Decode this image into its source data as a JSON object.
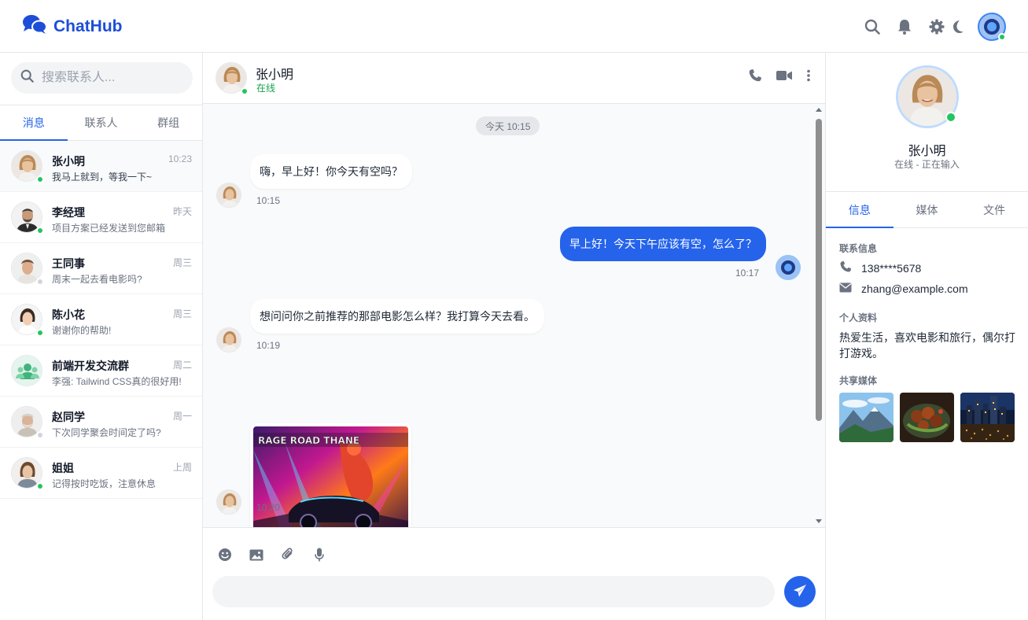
{
  "app": {
    "brand": "ChatHub"
  },
  "sidebar": {
    "search_placeholder": "搜索联系人...",
    "tabs": [
      {
        "label": "消息",
        "active": true
      },
      {
        "label": "联系人",
        "active": false
      },
      {
        "label": "群组",
        "active": false
      }
    ],
    "conversations": [
      {
        "name": "张小明",
        "time": "10:23",
        "preview": "我马上就到，等我一下~",
        "online": true
      },
      {
        "name": "李经理",
        "time": "昨天",
        "preview": "项目方案已经发送到您邮箱",
        "online": true
      },
      {
        "name": "王同事",
        "time": "周三",
        "preview": "周末一起去看电影吗?",
        "online": false
      },
      {
        "name": "陈小花",
        "time": "周三",
        "preview": "谢谢你的帮助!",
        "online": true
      },
      {
        "name": "前端开发交流群",
        "time": "周二",
        "preview": "李强: Tailwind CSS真的很好用!",
        "online": null
      },
      {
        "name": "赵同学",
        "time": "周一",
        "preview": "下次同学聚会时间定了吗?",
        "online": false
      },
      {
        "name": "姐姐",
        "time": "上周",
        "preview": "记得按时吃饭，注意休息",
        "online": true
      }
    ]
  },
  "chat": {
    "name": "张小明",
    "status": "在线",
    "date_divider": "今天 10:15",
    "messages": [
      {
        "from": "them",
        "text": "嗨，早上好！你今天有空吗？",
        "time": "10:15"
      },
      {
        "from": "me",
        "text": "早上好！今天下午应该有空，怎么了？",
        "time": "10:17"
      },
      {
        "from": "them",
        "text": "想问问你之前推荐的那部电影怎么样？我打算今天去看。",
        "time": "10:19"
      },
      {
        "from": "them",
        "type": "image",
        "image_text": "RAGE ROAD THANE",
        "time": "10:20"
      }
    ],
    "input_placeholder": ""
  },
  "profile": {
    "name": "张小明",
    "status": "在线 - 正在输入",
    "tabs": [
      {
        "label": "信息",
        "active": true
      },
      {
        "label": "媒体",
        "active": false
      },
      {
        "label": "文件",
        "active": false
      }
    ],
    "contact_title": "联系信息",
    "phone": "138****5678",
    "email": "zhang@example.com",
    "bio_title": "个人资料",
    "bio": "热爱生活，喜欢电影和旅行，偶尔打打游戏。",
    "media_title": "共享媒体"
  },
  "colors": {
    "accent": "#2563eb",
    "online": "#22c55e"
  }
}
